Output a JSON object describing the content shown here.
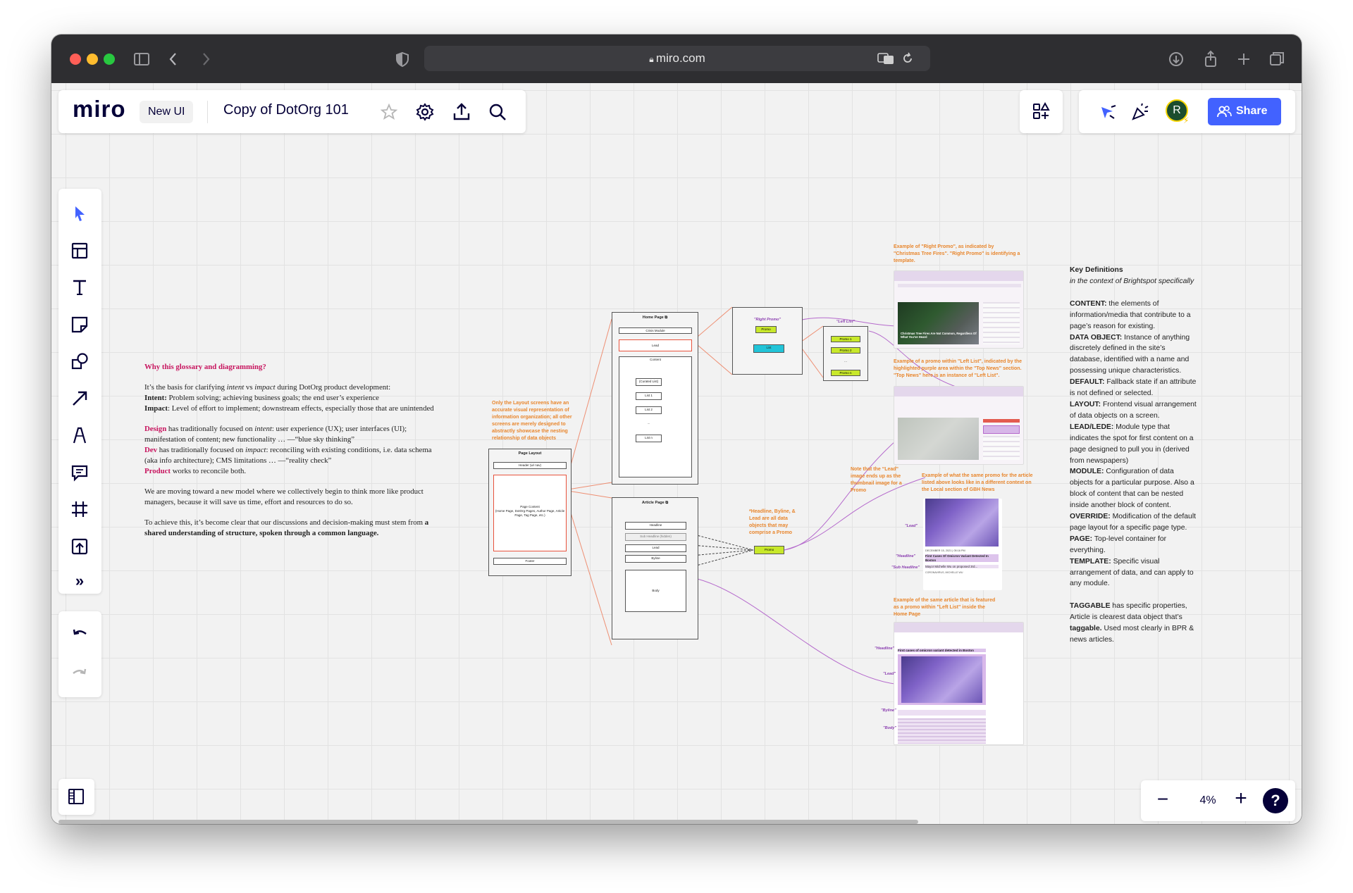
{
  "browser": {
    "url": "miro.com"
  },
  "header": {
    "logo": "miro",
    "badge": "New UI",
    "board_title": "Copy of DotOrg 101",
    "share_label": "Share",
    "avatar_initial": "R",
    "accent_color": "#4262ff"
  },
  "zoom": {
    "level": "4%",
    "minus": "−",
    "plus": "+",
    "help": "?"
  },
  "toolbar": {
    "more_label": "»"
  },
  "intro": {
    "heading": "Why this glossary and diagramming?",
    "p1_a": "It’s the basis for clarifying ",
    "p1_b": "intent",
    "p1_c": " vs ",
    "p1_d": "impact",
    "p1_e": " during DotOrg product development:",
    "intent_label": "Intent:",
    "intent_text": " Problem solving; achieving business goals; the end user’s experience",
    "impact_label": "Impact",
    "impact_text": ": Level of effort to implement; downstream effects, especially those that are unintended",
    "design_label": "Design",
    "design_a": " has traditionally focused on ",
    "design_b": "intent",
    "design_c": ": user experience (UX); user interfaces (UI); manifestation of content; new functionality … —“blue sky thinking”",
    "dev_label": "Dev",
    "dev_a": " has traditionally focused on ",
    "dev_b": "impact",
    "dev_c": ": reconciling with existing conditions, i.e. data schema (aka info architecture); CMS limitations … —“reality check”",
    "product_label": "Product",
    "product_text": " works to reconcile both.",
    "p3": "We are moving toward a new model where we collectively begin to think more like product managers, because it will save us time, effort and resources to do so.",
    "p4_a": "To achieve this, it’s become clear that our discussions and decision-making must stem from ",
    "p4_b": "a shared understanding of structure, spoken through a common language."
  },
  "definitions": {
    "title": "Key Definitions",
    "subtitle": "in the context of Brightspot specifically",
    "items": [
      {
        "term": "CONTENT:",
        "text": " the elements of information/media that contribute to a page’s reason for existing."
      },
      {
        "term": "DATA OBJECT:",
        "text": " Instance of anything discretely defined in the site’s database, identified with a name and possessing unique characteristics."
      },
      {
        "term": "DEFAULT:",
        "text": " Fallback state if an attribute is not defined or selected."
      },
      {
        "term": "LAYOUT:",
        "text": " Frontend visual arrangement of data objects on a screen."
      },
      {
        "term": "LEAD/LEDE:",
        "text": " Module type that indicates the spot for first content on a page designed to pull you in (derived from newspapers)"
      },
      {
        "term": "MODULE:",
        "text": " Configuration of data objects for a particular purpose. Also a block of content that can be nested inside another block of content."
      },
      {
        "term": "OVERRIDE:",
        "text": " Modification of the default page layout for a specific page type."
      },
      {
        "term": "PAGE:",
        "text": " Top-level container for everything."
      },
      {
        "term": "TEMPLATE:",
        "text": " Specific visual arrangement of data, and can apply to any module."
      }
    ],
    "taggable_term": "TAGGABLE",
    "taggable_a": " has specific properties, Article is clearest data object that’s ",
    "taggable_b": "taggable.",
    "taggable_c": " Used most clearly in BPR & news articles."
  },
  "diagram": {
    "layout_note": "Only the Layout screens have an accurate visual representation of information organization; all other screens are merely designed to abstractly showcase the nesting relationship of data objects",
    "page_layout": {
      "title": "Page Layout",
      "header": "Header (w/ nav)",
      "content": "Page Content\n(Home Page, DotOrg Pages, Author Page, Article Page, Tag Page, etc.)",
      "footer": "Footer"
    },
    "home_page": {
      "title": "Home Page ⧉",
      "crisis": "Crisis Module",
      "lead": "Lead",
      "content": "Content",
      "items": [
        "(Curated List)",
        "List 1",
        "List 2",
        "...",
        "List n"
      ]
    },
    "article_page": {
      "title": "Article Page ⧉",
      "headline": "Headline",
      "sub_headline": "Sub Headline (hidden)",
      "lead": "Lead",
      "byline": "Byline",
      "body": "Body"
    },
    "right_promo": {
      "label": "\"Right Promo\"",
      "promo": "Promo",
      "list": "List"
    },
    "left_list": {
      "label": "\"Left List\"",
      "items": [
        "Promo 1",
        "Promo 2",
        "...",
        "Promo n"
      ]
    },
    "promo_box": "Promo",
    "promo_note": "*Headline, Byline, & Lead are all data objects that may comprise a Promo",
    "lead_note": "Note that the “Lead” image ends up as the thumbnail image for a Promo",
    "example1": "Example of \"Right Promo\", as indicated by \"Christmas Tree Fires\". \"Right Promo\" is identifying a template.",
    "example2": "Example of a promo within \"Left List\", indicated by the highlighted purple area within the \"Top News\" section. \"Top News\" here is an instance of \"Left List\".",
    "example3": "Example of what the same promo for the article listed above looks like in a different context on the Local section of GBH News",
    "example4": "Example of the same article that is featured as a promo within \"Left List\" inside the Home Page",
    "shot1_caption": "Christmas Tree Fires Are Not Common, Regardless Of What You've Heard",
    "shot3_date": "DECEMBER 15, 2021 | 05:16 PM",
    "shot3_headline": "First Cases Of Omicron Variant Detected In Boston",
    "shot3_sub": "Mayor Michelle Wu on proposed 3rd...",
    "shot3_byline": "CORONAVIRUS, MICHELLE WU",
    "shot4_headline": "First cases of omicron variant detected in Boston",
    "tags": {
      "lead": "\"Lead\"",
      "headline": "\"Headline\"",
      "sub_headline": "\"Sub Headline\"",
      "byline": "\"Byline\"",
      "body": "\"Body\""
    }
  }
}
